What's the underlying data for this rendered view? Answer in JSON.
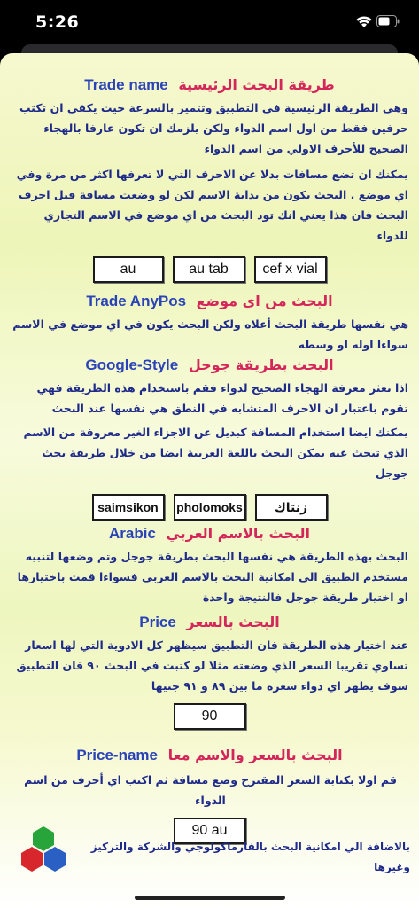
{
  "status_bar": {
    "time": "5:26"
  },
  "sections": [
    {
      "en": "Trade name",
      "ar": "طريقة البحث الرئيسية",
      "paras": [
        "وهي الطريقة الرئيسية في التطبيق وتتميز بالسرعة حيث يكفي ان تكتب حرفين فقط من اول اسم الدواء ولكن يلزمك ان تكون عارفا بالهجاء الصحيح للأحرف الاولي من اسم الدواء",
        "يمكنك ان تضع مسافات بدلا عن الاحرف التي لا تعرفها اكثر من مرة وفي اي موضع . البحث يكون من بداية الاسم لكن لو وضعت مسافة قبل احرف البحث فان هذا يعني انك تود البحث من اي موضع في الاسم التجاري للدواء"
      ],
      "chips": [
        "au",
        "au  tab",
        "cef  x  vial"
      ]
    },
    {
      "en": "Trade AnyPos",
      "ar": "البحث من اي موضع",
      "paras": [
        "هي نفسها طريقة البحث أعلاه ولكن البحث يكون في اي موضع في الاسم سواءا اوله او وسطه"
      ]
    },
    {
      "en": "Google-Style",
      "ar": "البحث بطريقة جوجل",
      "paras": [
        "اذا تعثر معرفة الهجاء الصحيح لدواء فقم باستخدام هذه الطريقة فهي تقوم باعتبار ان الاحرف المتشابه في النطق هي نفسها عند البحث",
        "يمكنك ايضا استخدام المسافة كبديل عن الاجزاء الغير معروفة من الاسم الذي تبحث عنه يمكن البحث باللغة العربية ايضا من خلال طريقة بحث جوجل"
      ],
      "chips": [
        "saimsikon",
        "pholomoks",
        "زنتاك"
      ]
    },
    {
      "en": "Arabic",
      "ar": "البحث بالاسم العربي",
      "paras": [
        "البحث بهذه الطريقة هي نفسها البحث بطريقة جوجل وتم وضعها لتنبيه مستخدم الطبيق الي امكانية البحث بالاسم العربي فسواءا قمت باختيارها او اختيار طريقة جوجل فالنتيجة واحدة"
      ]
    },
    {
      "en": "Price",
      "ar": "البحث بالسعر",
      "paras": [
        "عند اختيار هذه الطريقة فان التطبيق سيظهر كل الادوية التي لها اسعار تساوي تقريبا السعر الذي وضعته مثلا لو كتبت في البحث ٩٠ فان التطبيق سوف يظهر اي دواء سعره ما بين ٨٩ و ٩١ جنيها"
      ],
      "chips": [
        "90"
      ]
    },
    {
      "en": "Price-name",
      "ar": "البحث بالسعر والاسم معا",
      "paras": [
        "قم اولا بكتابة السعر المقترح وضع مسافة ثم اكتب اي أحرف من اسم الدواء"
      ],
      "chips": [
        "90  au"
      ]
    }
  ],
  "footer": {
    "text": "بالاضافة الي امكانية البحث بالفارماكولوجي والشركة والتركيز وغيرها"
  },
  "colors": {
    "heading_en": "#2a43b8",
    "heading_ar": "#d4265a",
    "body_text": "#1e2a8a"
  }
}
